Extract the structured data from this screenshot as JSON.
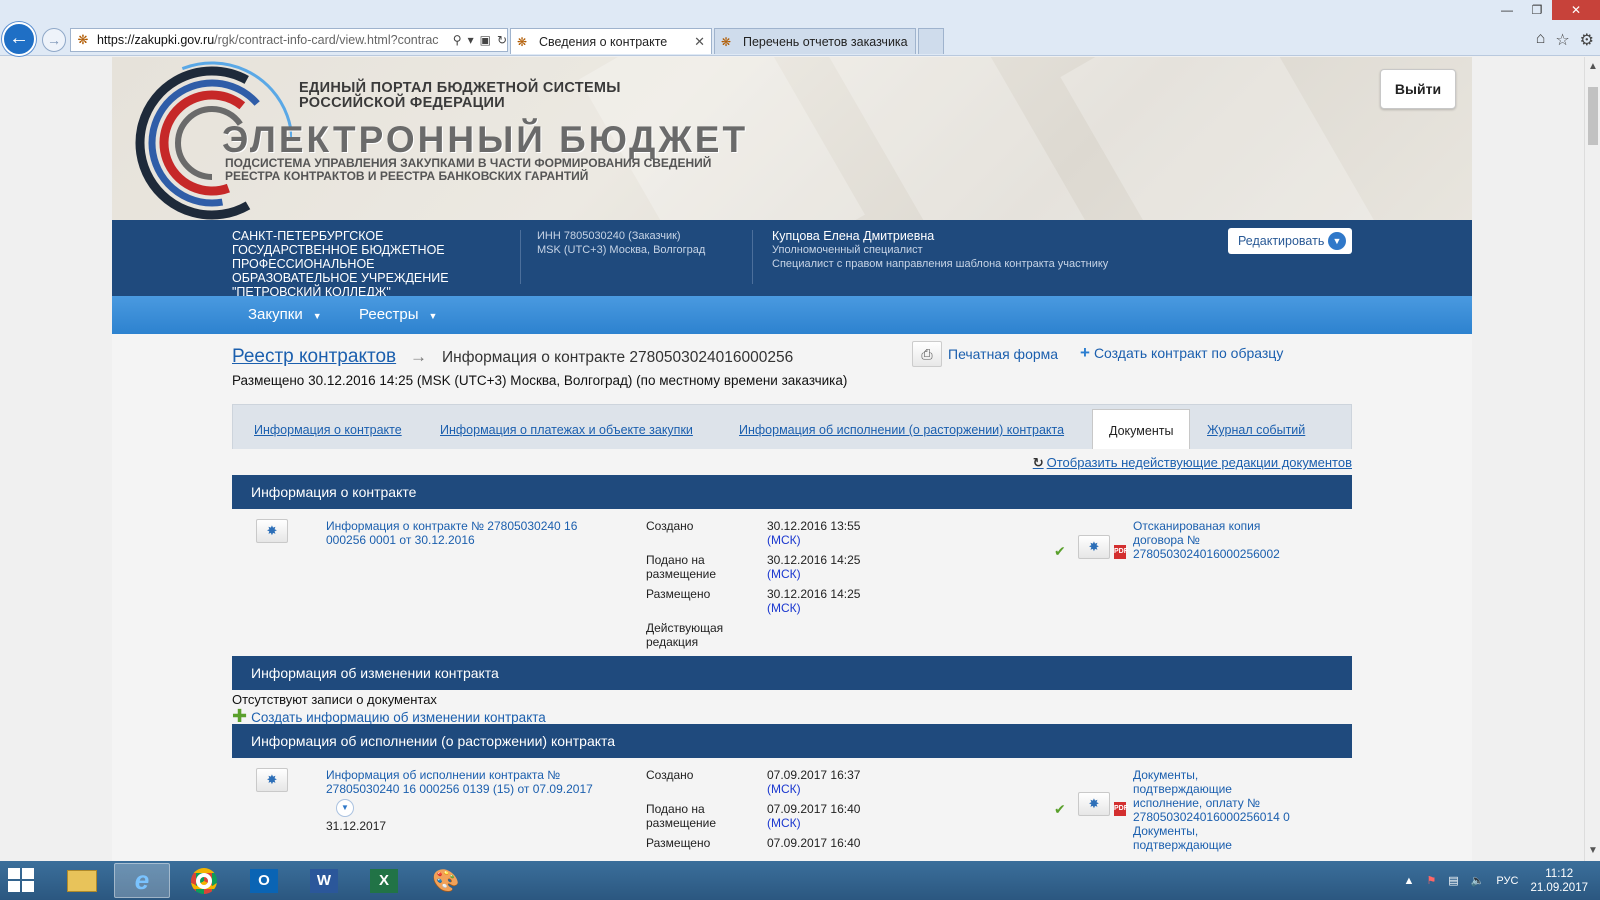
{
  "browser": {
    "url_domain": "https://zakupki.gov.ru",
    "url_rest": "/rgk/contract-info-card/view.html?contrac",
    "tabs": [
      {
        "label": "Сведения о контракте"
      },
      {
        "label": "Перечень отчетов заказчика"
      }
    ]
  },
  "banner": {
    "portal_line1": "ЕДИНЫЙ ПОРТАЛ БЮДЖЕТНОЙ СИСТЕМЫ",
    "portal_line2": "РОССИЙСКОЙ ФЕДЕРАЦИИ",
    "title": "ЭЛЕКТРОННЫЙ БЮДЖЕТ",
    "sub_line1": "ПОДСИСТЕМА УПРАВЛЕНИЯ ЗАКУПКАМИ В ЧАСТИ ФОРМИРОВАНИЯ СВЕДЕНИЙ",
    "sub_line2": "РЕЕСТРА КОНТРАКТОВ И РЕЕСТРА БАНКОВСКИХ ГАРАНТИЙ",
    "logout": "Выйти"
  },
  "org": {
    "name": "САНКТ-ПЕТЕРБУРГСКОЕ ГОСУДАРСТВЕННОЕ БЮДЖЕТНОЕ ПРОФЕССИОНАЛЬНОЕ ОБРАЗОВАТЕЛЬНОЕ УЧРЕЖДЕНИЕ \"ПЕТРОВСКИЙ КОЛЛЕДЖ\"",
    "inn": "ИНН 7805030240 (Заказчик)",
    "tz": "MSK (UTC+3) Москва, Волгоград",
    "user_name": "Купцова Елена Дмитриевна",
    "user_role1": "Уполномоченный специалист",
    "user_role2": "Специалист с правом направления шаблона контракта участнику",
    "edit": "Редактировать"
  },
  "menu": [
    {
      "label": "Закупки"
    },
    {
      "label": "Реестры"
    }
  ],
  "header": {
    "breadcrumb": "Реестр контрактов",
    "current": "Информация о контракте 2780503024016000256",
    "placed": "Размещено 30.12.2016 14:25 (MSK (UTC+3) Москва, Волгоград) (по местному времени заказчика)",
    "print": "Печатная форма",
    "create": "Создать контракт по образцу"
  },
  "tabs": [
    {
      "label": "Информация о контракте"
    },
    {
      "label": "Информация о платежах и объекте закупки"
    },
    {
      "label": "Информация об исполнении (о расторжении) контракта"
    },
    {
      "label": "Документы"
    },
    {
      "label": "Журнал событий"
    }
  ],
  "show_inactive": "Отобразить недействующие редакции документов",
  "sections": {
    "contract": {
      "title": "Информация о контракте",
      "doc_link_l1": "Информация о контракте № 27805030240 16",
      "doc_link_l2": "000256 0001 от 30.12.2016",
      "rows": [
        {
          "label_l1": "Создано",
          "label_l2": "",
          "date": "30.12.2016 13:55",
          "tz": "(МСК)"
        },
        {
          "label_l1": "Подано на",
          "label_l2": "размещение",
          "date": "30.12.2016 14:25",
          "tz": "(МСК)"
        },
        {
          "label_l1": "Размещено",
          "label_l2": "",
          "date": "30.12.2016 14:25",
          "tz": "(МСК)"
        },
        {
          "label_l1": "Действующая",
          "label_l2": "редакция",
          "date": "",
          "tz": ""
        }
      ],
      "attach_l1": "Отсканированая копия",
      "attach_l2": "договора №",
      "attach_l3": "2780503024016000256002"
    },
    "changes": {
      "title": "Информация об изменении контракта",
      "empty": "Отсутствуют записи о документах",
      "add": "Создать информацию об изменении контракта"
    },
    "execution": {
      "title": "Информация об исполнении (о расторжении) контракта",
      "doc_link_l1": "Информация об исполнении контракта №",
      "doc_link_l2": "27805030240 16 000256 0139 (15) от 07.09.2017",
      "doc_date": "31.12.2017",
      "rows": [
        {
          "label_l1": "Создано",
          "label_l2": "",
          "date": "07.09.2017 16:37",
          "tz": "(МСК)"
        },
        {
          "label_l1": "Подано на",
          "label_l2": "размещение",
          "date": "07.09.2017 16:40",
          "tz": "(МСК)"
        },
        {
          "label_l1": "Размещено",
          "label_l2": "",
          "date": "07.09.2017 16:40",
          "tz": ""
        }
      ],
      "attach_l1": "Документы,",
      "attach_l2": "подтверждающие",
      "attach_l3": "исполнение, оплату №",
      "attach_l4": "2780503024016000256014 0",
      "attach2_l1": "Документы,",
      "attach2_l2": "подтверждающие"
    }
  },
  "taskbar": {
    "lang": "РУС",
    "time": "11:12",
    "date": "21.09.2017"
  }
}
